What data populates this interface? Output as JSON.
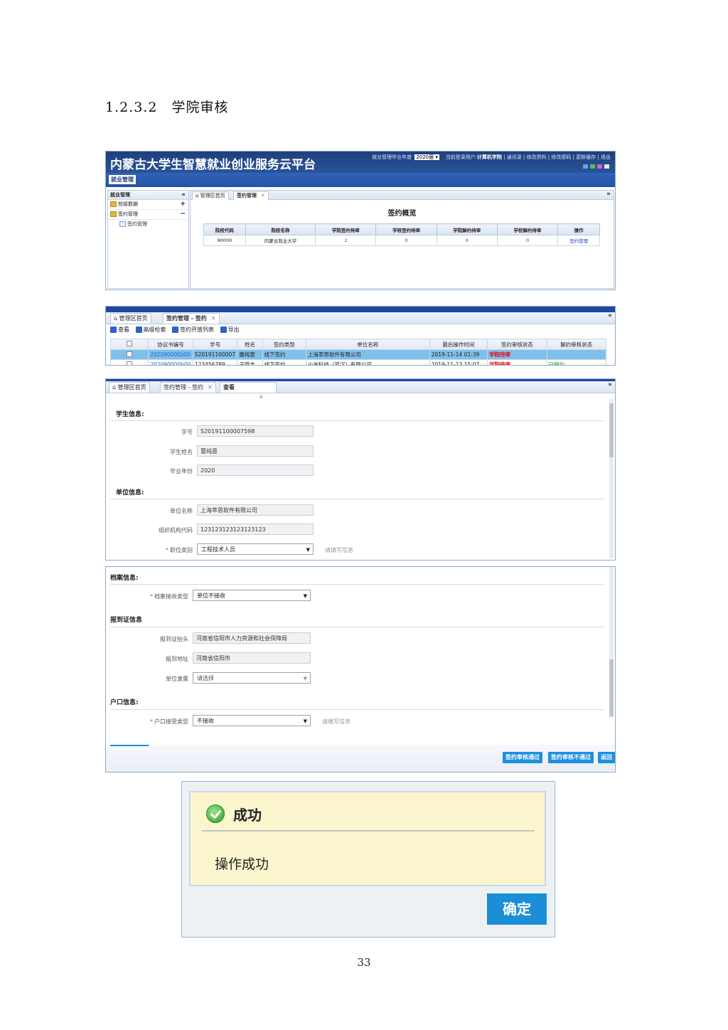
{
  "heading": "1.2.3.2　学院审核",
  "page_number": "33",
  "shot1": {
    "platform_title": "内蒙古大学生智慧就业创业服务云平台",
    "year_label": "就业管理毕业年度",
    "year_value": "2020届",
    "user_label": "当前登录用户:",
    "user_name": "计算机学院",
    "links": [
      "通讯录",
      "修改资料",
      "修改密码",
      "更新缓存",
      "退出"
    ],
    "nav_button": "就业管理",
    "sidebar": {
      "header": "就业管理",
      "collapse": "«",
      "items": [
        {
          "label": "校级数据",
          "toggle": "+"
        },
        {
          "label": "签约管理",
          "toggle": "−"
        }
      ],
      "subitem": "签约管理"
    },
    "tabs": [
      "管理区首页",
      "签约管理"
    ],
    "section_title": "签约概览",
    "table": {
      "headers": [
        "院校代码",
        "院校名称",
        "学院签约待审",
        "学校签约待审",
        "学院解约待审",
        "学校解约待审",
        "操作"
      ],
      "row": [
        "90000",
        "内蒙古就业大学",
        "2",
        "0",
        "0",
        "0",
        "签约管理"
      ]
    }
  },
  "shot2": {
    "tabs": [
      "管理区首页",
      "签约管理 - 签约"
    ],
    "toolbar": [
      "查看",
      "高级检索",
      "签约开放列表",
      "导出"
    ],
    "headers": [
      "协议书编号",
      "学号",
      "姓名",
      "签约类型",
      "单位名称",
      "最后操作时间",
      "签约审核状态",
      "解约审核状态"
    ],
    "rows": [
      [
        "202090000z00",
        "S20191100007",
        "蕾纯意",
        "线下签约",
        "上海萃思软件有限公司",
        "2019-11-14 01:39",
        "学院待审",
        ""
      ],
      [
        "202090000b00",
        "123456789",
        "王晓丰",
        "线下签约",
        "小米科技（武汉）有限公司",
        "2019-11-13 15:07",
        "学院待审",
        "已解约"
      ]
    ]
  },
  "shot3": {
    "tabs": [
      "管理区首页",
      "签约管理 - 签约",
      "查看"
    ],
    "student_section": "学生信息:",
    "student_no_label": "学号",
    "student_no": "S20191100007598",
    "student_name_label": "学生姓名",
    "student_name": "蕾纯意",
    "grad_year_label": "毕业年份",
    "grad_year": "2020",
    "company_section": "单位信息:",
    "company_name_label": "单位名称",
    "company_name": "上海萃思软件有限公司",
    "org_code_label": "组织机构代码",
    "org_code": "123123123123123123",
    "job_type_label": "职位类别",
    "job_type": "工程技术人员",
    "hint": "请填写信息"
  },
  "shot4": {
    "archive_section": "档案信息:",
    "archive_type_label": "档案接收类型",
    "archive_type": "单位不接收",
    "report_section": "报到证信息",
    "report_head_label": "报到证抬头",
    "report_head": "河南省信阳市人力资源和社会保障局",
    "report_addr_label": "报到地址",
    "report_addr": "河南省信阳市",
    "affiliation_label": "单位隶属",
    "affiliation": "请选择",
    "hukou_section": "户口信息:",
    "hukou_type_label": "户口接受类型",
    "hukou_type": "不接收",
    "hint": "请填写信息",
    "buttons": [
      "签约审核通过",
      "签约审核不通过",
      "返回"
    ]
  },
  "dialog": {
    "title": "成功",
    "message": "操作成功",
    "ok_label": "确定"
  },
  "colors": {
    "banner": "#1f3f7c",
    "selected_row": "#7fc0ea",
    "primary_button": "#1e8fe0",
    "dialog_body": "#fbf6ce"
  }
}
